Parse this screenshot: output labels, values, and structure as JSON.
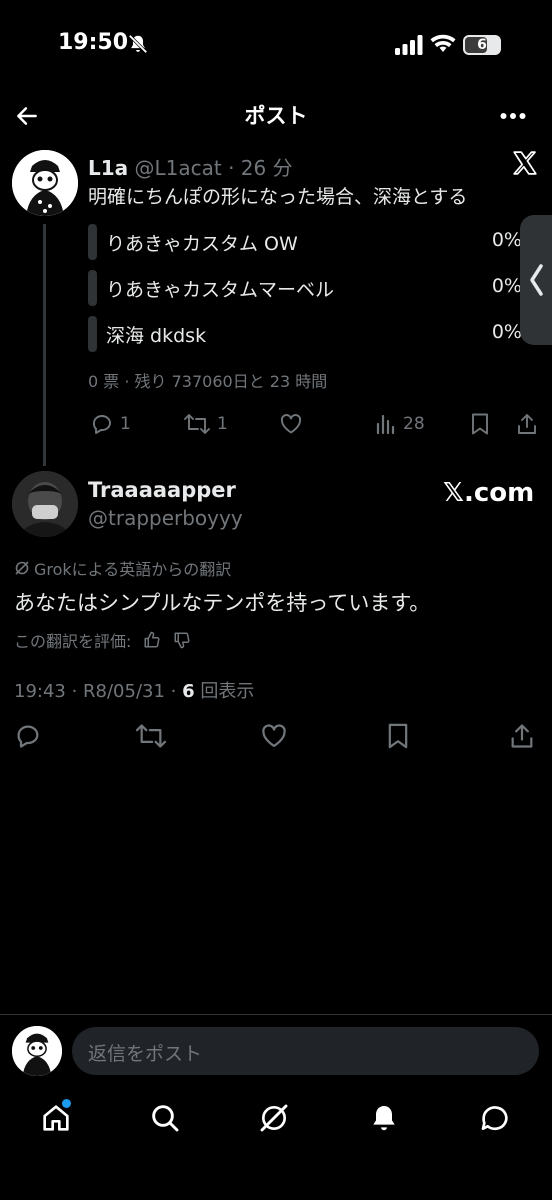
{
  "status_bar": {
    "time": "19:50",
    "battery": "6"
  },
  "header": {
    "title": "ポスト"
  },
  "post": {
    "author_name": "L1a",
    "author_handle": "@L1acat",
    "time_ago": "· 26 分",
    "text": "明確にちんぽの形になった場合、深海とする",
    "poll": {
      "options": [
        {
          "label": "りあきゃカスタム OW",
          "percent": "0%"
        },
        {
          "label": "りあきゃカスタムマーベル",
          "percent": "0%"
        },
        {
          "label": "深海 dkdsk",
          "percent": "0%"
        }
      ],
      "meta": "0 票 · 残り 737060日と 23 時間"
    },
    "actions": {
      "reply_count": "1",
      "repost_count": "1",
      "views_count": "28"
    }
  },
  "reply": {
    "author_name": "Traaaaapper",
    "author_handle": "@trapperboyyy",
    "watermark": "𝕏.com",
    "translation_note": "Grokによる英語からの翻訳",
    "text": "あなたはシンプルなテンポを持っています。",
    "rate_label": "この翻訳を評価:",
    "timestamp": "19:43 · R8/05/31 · ",
    "views_number": "6",
    "views_label": " 回表示"
  },
  "composer": {
    "placeholder": "返信をポスト"
  },
  "icons": {
    "back": "arrow-left-icon",
    "more": "more-icon",
    "x_logo": "x-logo-icon",
    "reply": "reply-icon",
    "repost": "repost-icon",
    "like": "heart-icon",
    "views": "views-icon",
    "bookmark": "bookmark-icon",
    "share": "share-icon",
    "home": "home-icon",
    "search": "search-icon",
    "grok": "grok-icon",
    "notifications": "bell-icon",
    "messages": "messages-icon"
  },
  "colors": {
    "background": "#000000",
    "text": "#e7e9ea",
    "muted": "#71767b",
    "accent": "#1d9bf0"
  }
}
